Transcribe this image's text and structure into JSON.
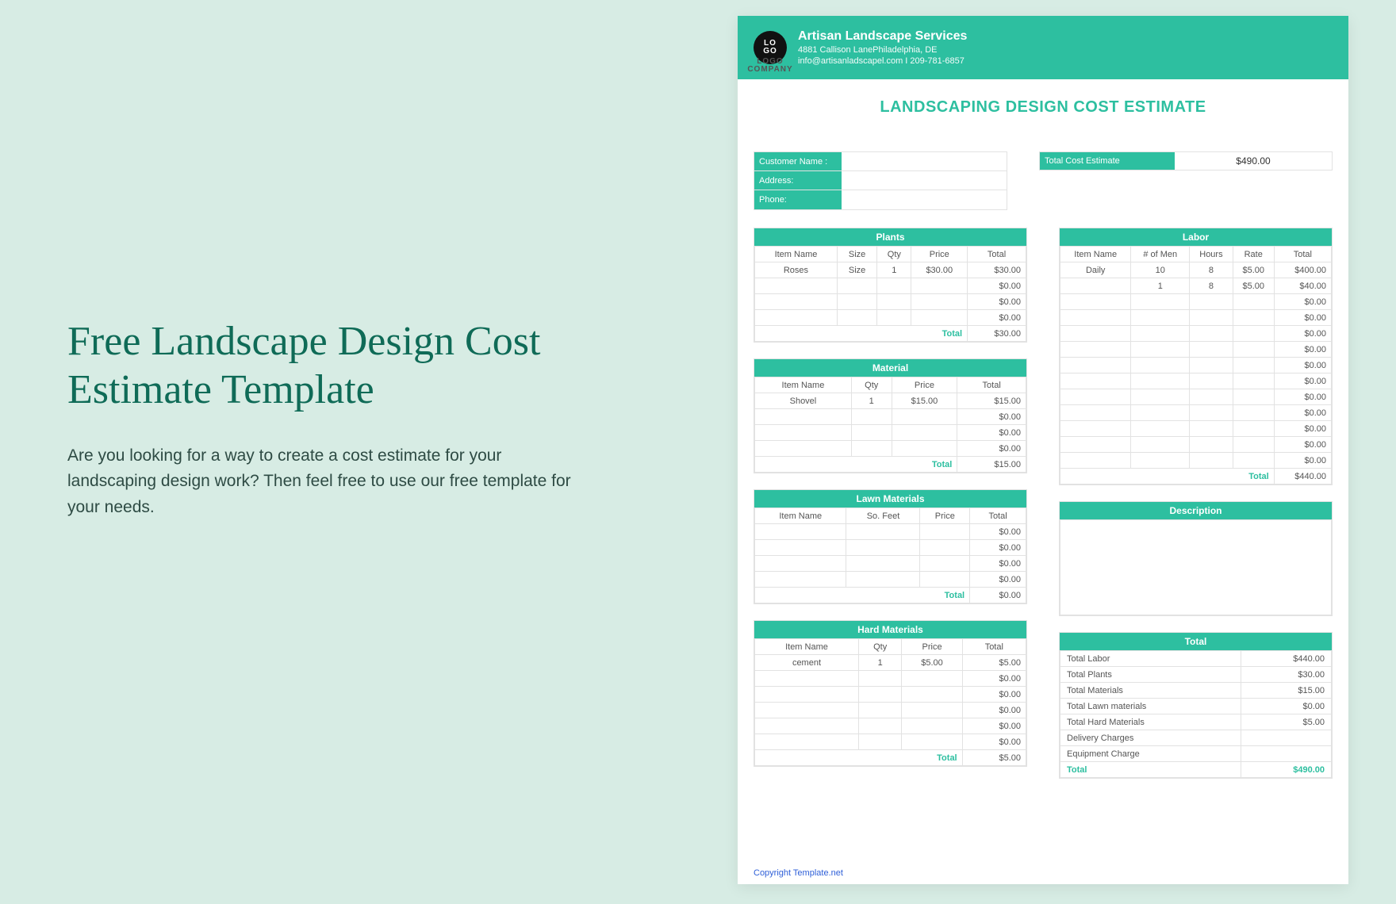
{
  "hero": {
    "title": "Free Landscape Design Cost Estimate Template",
    "description": "Are you looking for a way to create a cost estimate for your landscaping design work? Then feel free to use our free template for your needs."
  },
  "header": {
    "logo_text": "LO\nGO",
    "logo_sub": "LOGO COMPANY",
    "company": "Artisan Landscape Services",
    "address": "4881 Callison LanePhiladelphia, DE",
    "contact": "info@artisanladscapel.com I  209-781-6857"
  },
  "doc_title": "LANDSCAPING DESIGN COST ESTIMATE",
  "customer": {
    "name_label": "Customer Name :",
    "address_label": "Address:",
    "phone_label": "Phone:",
    "name": "",
    "address": "",
    "phone": ""
  },
  "total_cost": {
    "label": "Total Cost Estimate",
    "value": "$490.00"
  },
  "plants": {
    "title": "Plants",
    "headers": [
      "Item Name",
      "Size",
      "Qty",
      "Price",
      "Total"
    ],
    "rows": [
      [
        "Roses",
        "Size",
        "1",
        "$30.00",
        "$30.00"
      ],
      [
        "",
        "",
        "",
        "",
        "$0.00"
      ],
      [
        "",
        "",
        "",
        "",
        "$0.00"
      ],
      [
        "",
        "",
        "",
        "",
        "$0.00"
      ]
    ],
    "total_label": "Total",
    "total": "$30.00"
  },
  "material": {
    "title": "Material",
    "headers": [
      "Item Name",
      "Qty",
      "Price",
      "Total"
    ],
    "rows": [
      [
        "Shovel",
        "1",
        "$15.00",
        "$15.00"
      ],
      [
        "",
        "",
        "",
        "$0.00"
      ],
      [
        "",
        "",
        "",
        "$0.00"
      ],
      [
        "",
        "",
        "",
        "$0.00"
      ]
    ],
    "total_label": "Total",
    "total": "$15.00"
  },
  "lawn": {
    "title": "Lawn Materials",
    "headers": [
      "Item Name",
      "So. Feet",
      "Price",
      "Total"
    ],
    "rows": [
      [
        "",
        "",
        "",
        "$0.00"
      ],
      [
        "",
        "",
        "",
        "$0.00"
      ],
      [
        "",
        "",
        "",
        "$0.00"
      ],
      [
        "",
        "",
        "",
        "$0.00"
      ]
    ],
    "total_label": "Total",
    "total": "$0.00"
  },
  "hard": {
    "title": "Hard Materials",
    "headers": [
      "Item Name",
      "Qty",
      "Price",
      "Total"
    ],
    "rows": [
      [
        "cement",
        "1",
        "$5.00",
        "$5.00"
      ],
      [
        "",
        "",
        "",
        "$0.00"
      ],
      [
        "",
        "",
        "",
        "$0.00"
      ],
      [
        "",
        "",
        "",
        "$0.00"
      ],
      [
        "",
        "",
        "",
        "$0.00"
      ],
      [
        "",
        "",
        "",
        "$0.00"
      ]
    ],
    "total_label": "Total",
    "total": "$5.00"
  },
  "labor": {
    "title": "Labor",
    "headers": [
      "Item Name",
      "# of Men",
      "Hours",
      "Rate",
      "Total"
    ],
    "rows": [
      [
        "Daily",
        "10",
        "8",
        "$5.00",
        "$400.00"
      ],
      [
        "",
        "1",
        "8",
        "$5.00",
        "$40.00"
      ],
      [
        "",
        "",
        "",
        "",
        "$0.00"
      ],
      [
        "",
        "",
        "",
        "",
        "$0.00"
      ],
      [
        "",
        "",
        "",
        "",
        "$0.00"
      ],
      [
        "",
        "",
        "",
        "",
        "$0.00"
      ],
      [
        "",
        "",
        "",
        "",
        "$0.00"
      ],
      [
        "",
        "",
        "",
        "",
        "$0.00"
      ],
      [
        "",
        "",
        "",
        "",
        "$0.00"
      ],
      [
        "",
        "",
        "",
        "",
        "$0.00"
      ],
      [
        "",
        "",
        "",
        "",
        "$0.00"
      ],
      [
        "",
        "",
        "",
        "",
        "$0.00"
      ],
      [
        "",
        "",
        "",
        "",
        "$0.00"
      ]
    ],
    "total_label": "Total",
    "total": "$440.00"
  },
  "description": {
    "title": "Description"
  },
  "summary": {
    "title": "Total",
    "rows": [
      [
        "Total Labor",
        "$440.00"
      ],
      [
        "Total Plants",
        "$30.00"
      ],
      [
        "Total Materials",
        "$15.00"
      ],
      [
        "Total Lawn materials",
        "$0.00"
      ],
      [
        "Total Hard Materials",
        "$5.00"
      ],
      [
        "Delivery Charges",
        ""
      ],
      [
        "Equipment Charge",
        ""
      ]
    ],
    "grand_label": "Total",
    "grand_total": "$490.00"
  },
  "copyright": "Copyright Template.net"
}
